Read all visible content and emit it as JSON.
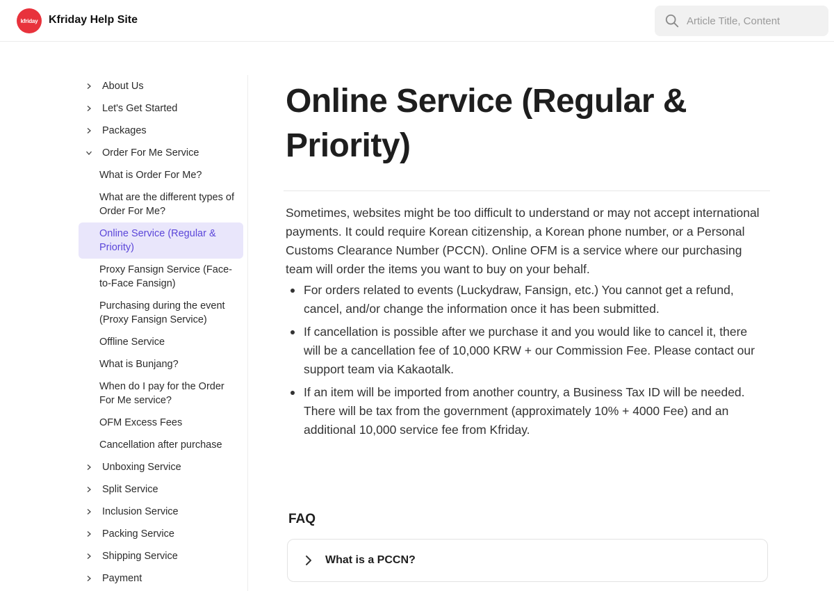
{
  "header": {
    "logo_text": "kfriday",
    "site_title": "Kfriday Help Site",
    "search_placeholder": "Article Title, Content"
  },
  "sidebar": {
    "items": [
      {
        "label": "About Us",
        "expanded": false
      },
      {
        "label": "Let's Get Started",
        "expanded": false
      },
      {
        "label": "Packages",
        "expanded": false
      },
      {
        "label": "Order For Me Service",
        "expanded": true
      },
      {
        "label": "Unboxing Service",
        "expanded": false
      },
      {
        "label": "Split Service",
        "expanded": false
      },
      {
        "label": "Inclusion Service",
        "expanded": false
      },
      {
        "label": "Packing Service",
        "expanded": false
      },
      {
        "label": "Shipping Service",
        "expanded": false
      },
      {
        "label": "Payment",
        "expanded": false
      }
    ],
    "subitems": [
      {
        "label": "What is Order For Me?"
      },
      {
        "label": "What are the different types of Order For Me?"
      },
      {
        "label": "Online Service (Regular & Priority)",
        "active": true
      },
      {
        "label": "Proxy Fansign Service (Face-to-Face Fansign)"
      },
      {
        "label": "Purchasing during the event (Proxy Fansign Service)"
      },
      {
        "label": "Offline Service"
      },
      {
        "label": "What is Bunjang?"
      },
      {
        "label": "When do I pay for the Order For Me service?"
      },
      {
        "label": "OFM Excess Fees"
      },
      {
        "label": "Cancellation after purchase"
      }
    ]
  },
  "article": {
    "title": "Online Service (Regular & Priority)",
    "intro": "Sometimes, websites might be too difficult to understand or may not accept international payments. It could require Korean citizenship, a Korean phone number, or a Personal Customs Clearance Number (PCCN). Online OFM is a service where our purchasing team will order the items you want to buy on your behalf.",
    "bullets": [
      "For orders related to events (Luckydraw, Fansign, etc.) You cannot get a refund, cancel, and/or change the information once it has been submitted.",
      "If cancellation is possible after we purchase it and you would like to cancel it, there will be a cancellation fee of 10,000 KRW + our Commission Fee. Please contact our support team via Kakaotalk.",
      "If an item will be imported from another country, a Business Tax ID will be needed. There will be tax from the government (approximately 10% + 4000 Fee) and an additional 10,000 service fee from Kfriday."
    ]
  },
  "faq": {
    "title": "FAQ",
    "questions": [
      {
        "question": "What is a PCCN?"
      }
    ]
  },
  "colors": {
    "brand": "#e8323c",
    "active_bg": "#e9e6fb",
    "active_text": "#5b46d9"
  },
  "icons": [
    "search-icon",
    "chevron-right-icon",
    "chevron-down-icon"
  ]
}
